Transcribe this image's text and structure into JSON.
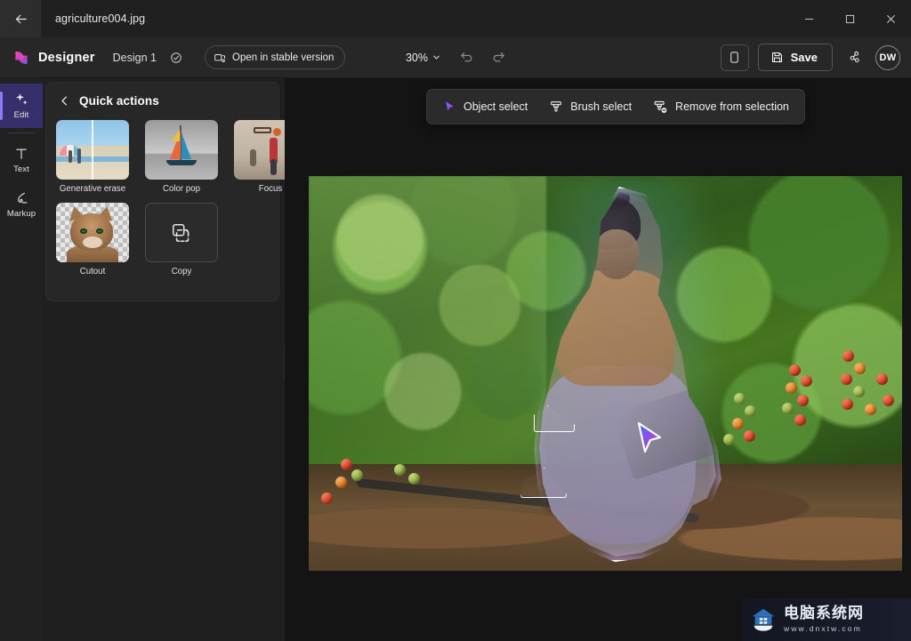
{
  "titlebar": {
    "back_icon": "arrow-left-icon",
    "document_title": "agriculture004.jpg",
    "minimize_label": "—",
    "maximize_label": "☐",
    "close_label": "✕"
  },
  "header": {
    "brand": "Designer",
    "design_name": "Design 1",
    "saved_icon": "cloud-saved-icon",
    "open_stable_label": "Open in stable version",
    "open_stable_icon": "open-external-icon",
    "zoom_level": "30%",
    "zoom_chevron_icon": "chevron-down-icon",
    "undo_icon": "undo-icon",
    "redo_icon": "redo-icon",
    "device_preview_icon": "device-preview-icon",
    "save_label": "Save",
    "save_icon": "floppy-disk-icon",
    "share_icon": "share-people-icon",
    "avatar_initials": "DW",
    "accent_color": "#8b7cf6"
  },
  "rail": {
    "items": [
      {
        "label": "Edit",
        "icon": "sparkles-icon",
        "active": true
      },
      {
        "label": "Text",
        "icon": "text-t-icon",
        "active": false
      },
      {
        "label": "Markup",
        "icon": "markup-pen-icon",
        "active": false
      }
    ]
  },
  "panel": {
    "back_icon": "chevron-left-icon",
    "title": "Quick actions",
    "actions": [
      {
        "label": "Generative erase",
        "thumb": "beach-split-thumb"
      },
      {
        "label": "Color pop",
        "thumb": "sailboat-thumb"
      },
      {
        "label": "Focus",
        "thumb": "basketball-thumb"
      },
      {
        "label": "Cutout",
        "thumb": "cat-transparent-thumb"
      },
      {
        "label": "Copy",
        "thumb": "copy-outline-icon"
      }
    ],
    "collapse_icon": "chevron-left-icon"
  },
  "selection_toolbar": {
    "items": [
      {
        "label": "Object select",
        "icon": "object-select-cursor-icon",
        "active": true
      },
      {
        "label": "Brush select",
        "icon": "brush-icon",
        "active": false
      },
      {
        "label": "Remove from selection",
        "icon": "remove-selection-icon",
        "active": false
      }
    ]
  },
  "canvas": {
    "image_alt": "Woman in greenhouse tomato rows with tablet",
    "selection_state": "object-selected",
    "cursor_icon": "gradient-arrow-cursor"
  },
  "watermark": {
    "site_name": "电脑系统网",
    "url": "www.dnxtw.com",
    "badge_icon": "house-badge-icon"
  }
}
